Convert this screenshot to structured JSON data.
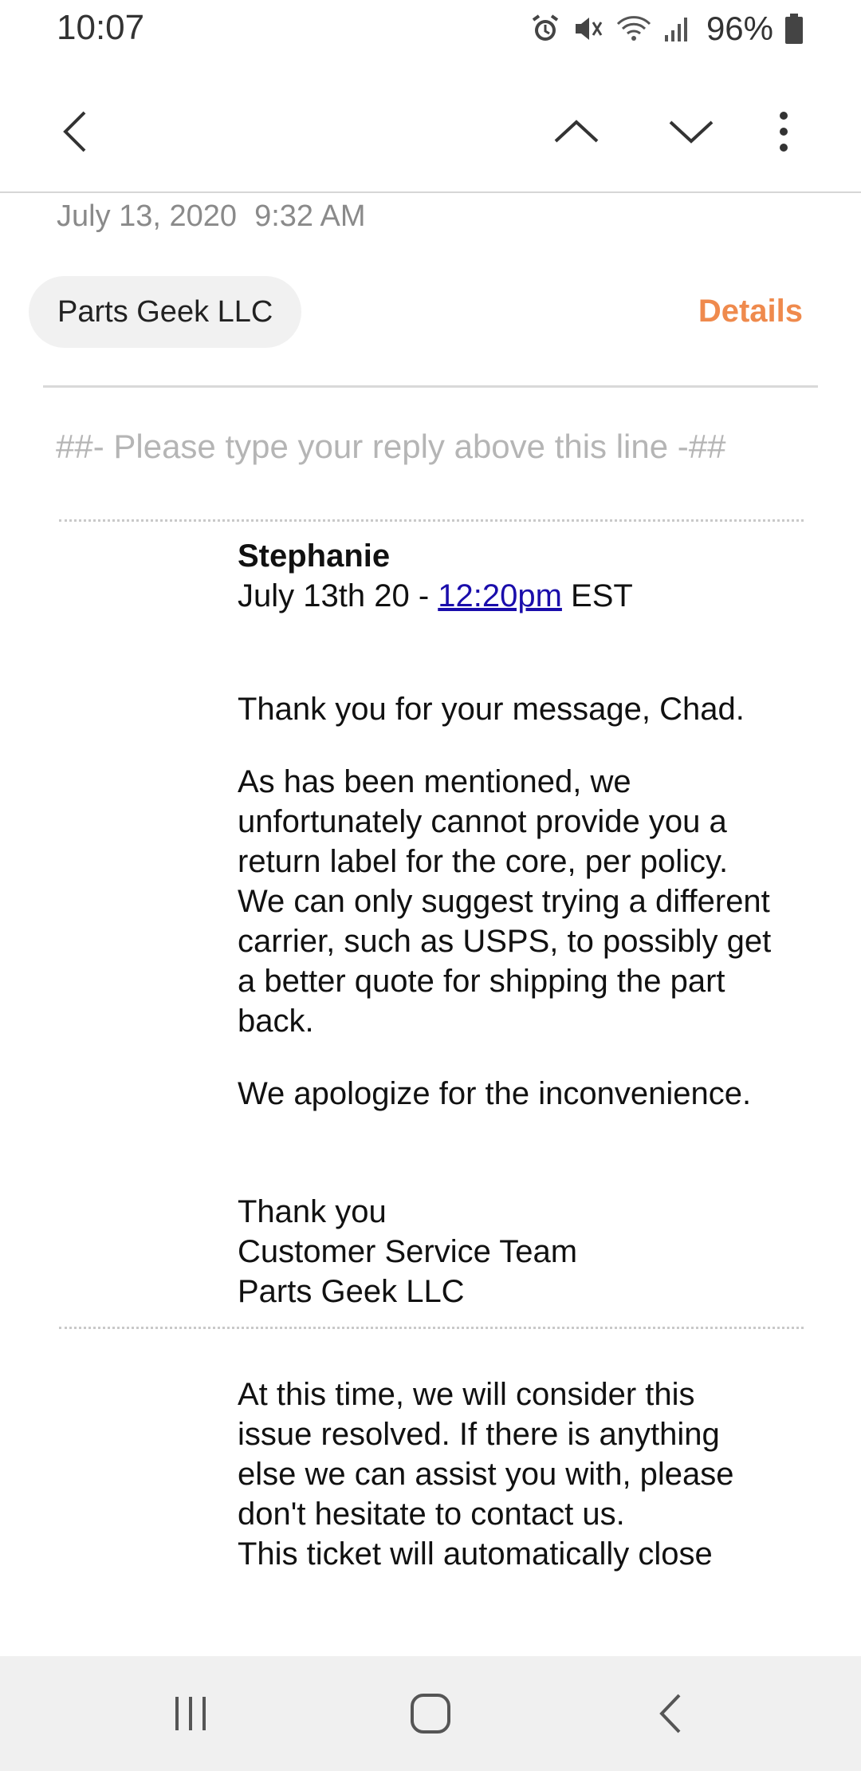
{
  "status_bar": {
    "time": "10:07",
    "battery": "96%",
    "icons": [
      "alarm-icon",
      "mute-icon",
      "wifi-icon",
      "signal-icon",
      "battery-icon"
    ]
  },
  "app_bar": {
    "icons": [
      "back-arrow-icon",
      "chevron-up-icon",
      "chevron-down-icon",
      "more-vert-icon"
    ]
  },
  "email": {
    "date": "July 13, 2020",
    "time": "9:32 AM",
    "sender": "Parts Geek LLC",
    "details_label": "Details",
    "reply_marker": "##- Please type your reply above this line -##",
    "message": {
      "author": "Stephanie",
      "date_prefix": "July 13th 20 - ",
      "time_link": "12:20pm",
      "tz": " EST",
      "p1": "Thank you for your message, Chad.",
      "p2_lines": [
        "As has been mentioned, we",
        "unfortunately cannot provide you a",
        "return label for the core, per policy.",
        "We can only suggest trying a different",
        "carrier, such as USPS, to possibly get",
        "a better quote for shipping the part",
        "back."
      ],
      "p3": "We apologize for the inconvenience.",
      "signoff": [
        "Thank you",
        "Customer Service Team",
        "Parts Geek LLC"
      ]
    },
    "footer_lines": [
      "At this time, we will consider this",
      "issue resolved. If there is anything",
      "else we can assist you with, please",
      "don't hesitate to contact us.",
      "This ticket will automatically close"
    ]
  },
  "nav_bar": {
    "icons": [
      "recent-apps-icon",
      "home-icon",
      "back-icon"
    ]
  },
  "colors": {
    "accent": "#ef8a4d",
    "link": "#1a0dab",
    "muted": "#8a8a8a"
  }
}
